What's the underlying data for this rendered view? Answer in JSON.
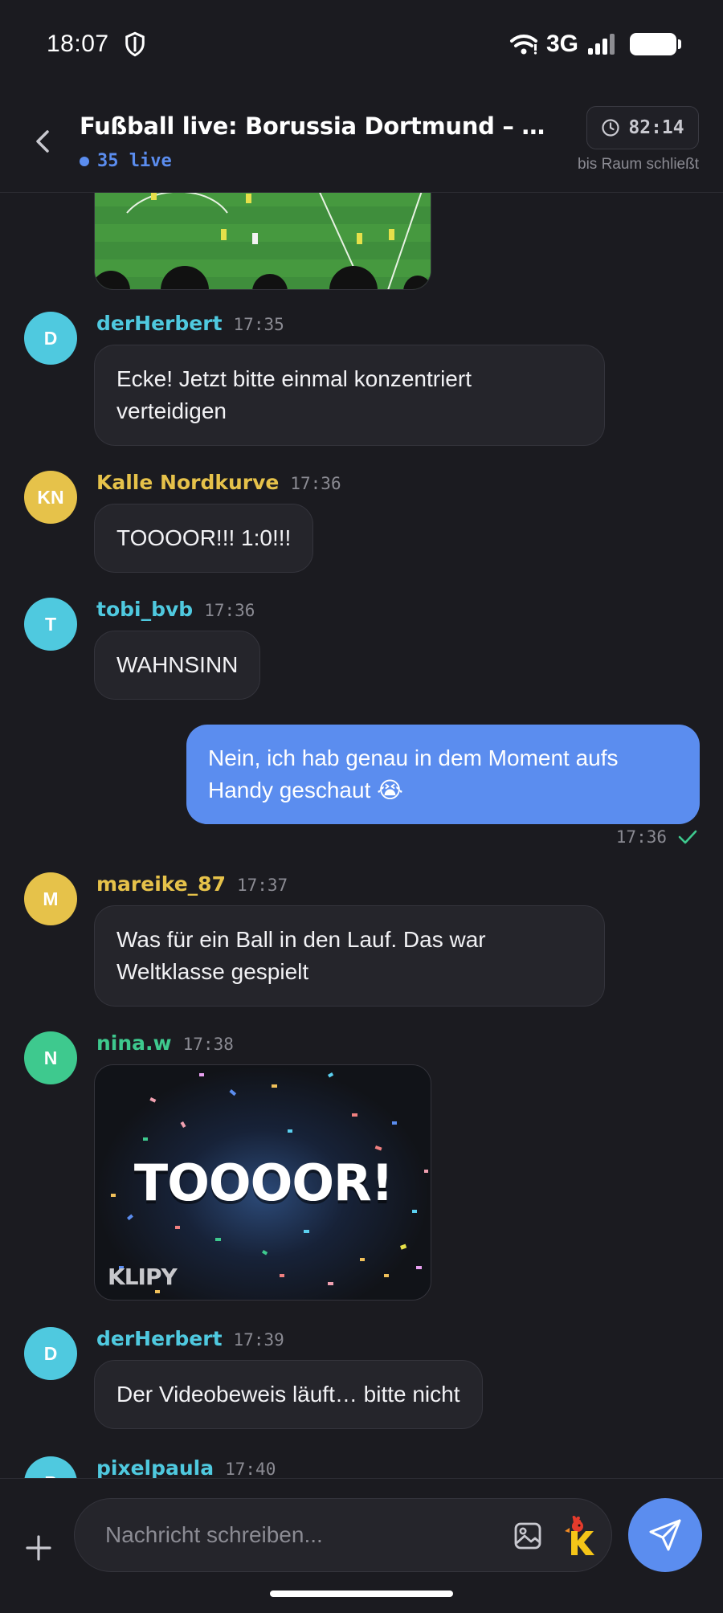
{
  "status": {
    "time": "18:07",
    "network": "3G"
  },
  "header": {
    "title": "Fußball live: Borussia Dortmund – RB L...",
    "live": "35 live",
    "timer": "82:14",
    "timer_sub": "bis Raum schließt"
  },
  "messages": [
    {
      "initials": "D",
      "user": "derHerbert",
      "time": "17:35",
      "text_lines": [
        "Ecke! Jetzt bitte einmal konzentriert",
        "verteidigen"
      ],
      "avatar_color": "#4fc9df",
      "name_color": "#4fc9df"
    },
    {
      "initials": "KN",
      "user": "Kalle Nordkurve",
      "time": "17:36",
      "text": "TOOOOR!!! 1:0!!!",
      "avatar_color": "#e6c24a",
      "name_color": "#e6c24a"
    },
    {
      "initials": "T",
      "user": "tobi_bvb",
      "time": "17:36",
      "text": "WAHNSINN",
      "avatar_color": "#4fc9df",
      "name_color": "#4fc9df"
    },
    {
      "initials": "M",
      "user": "mareike_87",
      "time": "17:37",
      "text_lines": [
        "Was für ein Ball in den Lauf. Das war",
        "Weltklasse gespielt"
      ],
      "avatar_color": "#e6c24a",
      "name_color": "#e6c24a"
    },
    {
      "initials": "N",
      "user": "nina.w",
      "time": "17:38",
      "gif_text": "TOOOOR!",
      "gif_brand": "KLIPY",
      "avatar_color": "#3ec98e",
      "name_color": "#3ec98e"
    },
    {
      "initials": "D",
      "user": "derHerbert",
      "time": "17:39",
      "text": "Der Videobeweis läuft… bitte nicht",
      "avatar_color": "#4fc9df",
      "name_color": "#4fc9df"
    },
    {
      "initials": "P",
      "user": "pixelpaula",
      "time": "17:40",
      "avatar_color": "#4fc9df",
      "name_color": "#4fc9df"
    }
  ],
  "own_message": {
    "text_lines": [
      "Nein, ich hab genau in dem Moment aufs",
      "Handy geschaut 😭"
    ],
    "time": "17:36",
    "color": "#5b8def"
  },
  "composer": {
    "placeholder": "Nachricht schreiben..."
  },
  "colors": {
    "background": "#1b1b20",
    "bubble": "#25252b",
    "accent": "#5b8def",
    "read_check": "#3ec98e"
  },
  "icons": [
    "shield-icon",
    "wifi-icon",
    "signal-icon",
    "battery-icon",
    "back-arrow-icon",
    "clock-icon",
    "plus-icon",
    "image-icon",
    "klipy-icon",
    "send-icon",
    "check-icon"
  ]
}
